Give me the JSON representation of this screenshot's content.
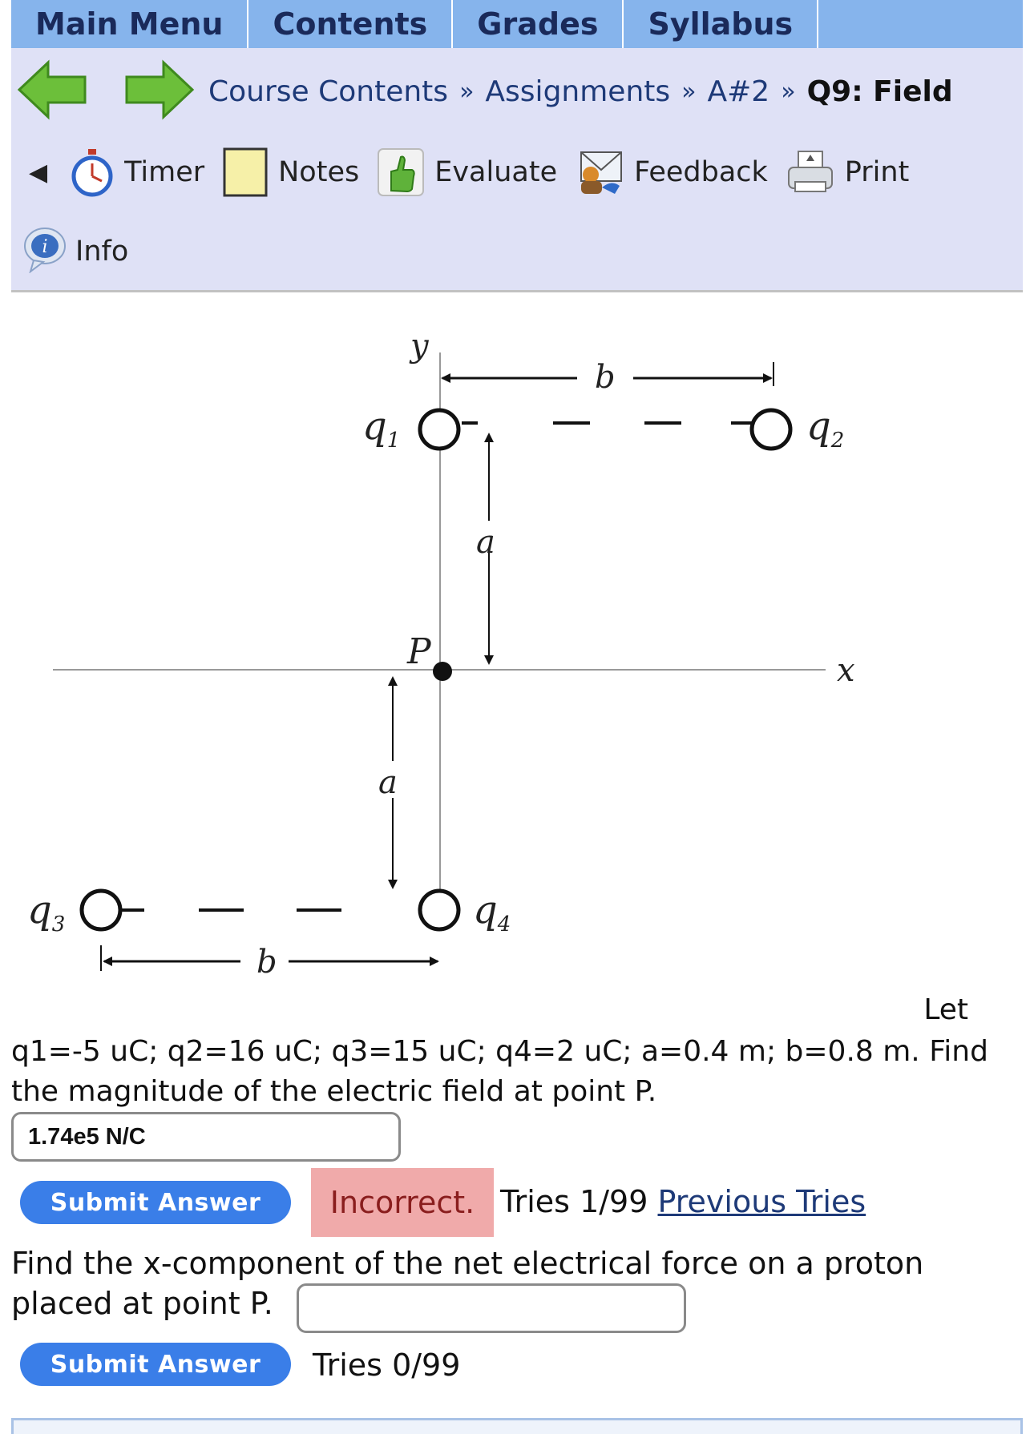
{
  "topnav": {
    "tabs": [
      "Main Menu",
      "Contents",
      "Grades",
      "Syllabus"
    ]
  },
  "breadcrumb": {
    "items": [
      "Course Contents",
      "Assignments",
      "A#2"
    ],
    "current": "Q9: Field",
    "separator": "»"
  },
  "toolbar": {
    "collapse_glyph": "◀",
    "timer": "Timer",
    "notes": "Notes",
    "evaluate": "Evaluate",
    "feedback": "Feedback",
    "print": "Print",
    "info": "Info"
  },
  "diagram": {
    "labels": {
      "y": "y",
      "x": "x",
      "P": "P",
      "a_top": "a",
      "a_bottom": "a",
      "b_top": "b",
      "b_bottom": "b",
      "q1": "q",
      "q1_sub": "1",
      "q2": "q",
      "q2_sub": "2",
      "q3": "q",
      "q3_sub": "3",
      "q4": "q",
      "q4_sub": "4"
    }
  },
  "question1": {
    "let_word": "Let",
    "text": "q1=-5 uC; q2=16 uC; q3=15 uC; q4=2 uC; a=0.4 m; b=0.8 m. Find the magnitude of the electric field at point P.",
    "answer_value": "1.74e5 N/C",
    "submit_label": "Submit Answer",
    "status": "Incorrect.",
    "tries": "Tries 1/99",
    "previous_tries": "Previous Tries"
  },
  "question2": {
    "text_line1": "Find the x-component of the net electrical force on a proton",
    "text_line2": "placed at point P.",
    "answer_value": "",
    "submit_label": "Submit Answer",
    "tries": "Tries 0/99"
  },
  "colors": {
    "topnav_bg": "#86b4ec",
    "subbar_bg": "#dfe1f6",
    "submit_bg": "#3a7ee8",
    "incorrect_bg": "#f0aaaa",
    "link": "#1e3a78"
  }
}
